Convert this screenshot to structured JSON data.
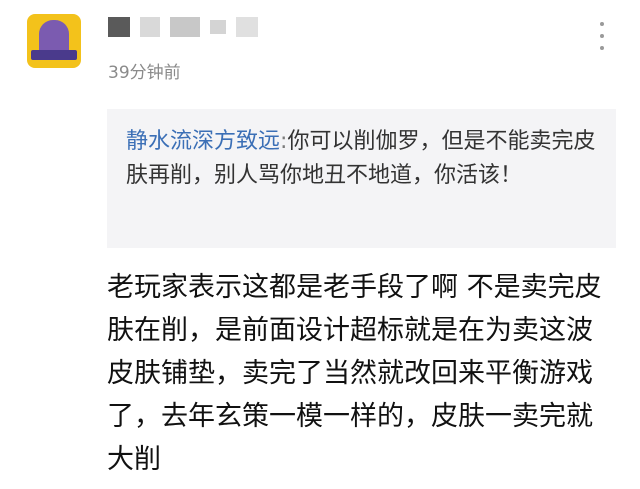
{
  "comment": {
    "time": "39分钟前",
    "quote": {
      "author": "静水流深方致远",
      "separator": ":",
      "text": "你可以削伽罗，但是不能卖完皮肤再削，别人骂你地丑不地道，你活该！"
    },
    "body": "老玩家表示这都是老手段了啊 不是卖完皮肤在削，是前面设计超标就是在为卖这波皮肤铺垫，卖完了当然就改回来平衡游戏了，去年玄策一模一样的，皮肤一卖完就大削"
  },
  "icons": {
    "more": "more-vertical-icon",
    "avatar": "avatar-image"
  },
  "colors": {
    "author_link": "#3b6fb6",
    "quote_bg": "#f4f4f6",
    "meta_text": "#8a8a8a"
  }
}
